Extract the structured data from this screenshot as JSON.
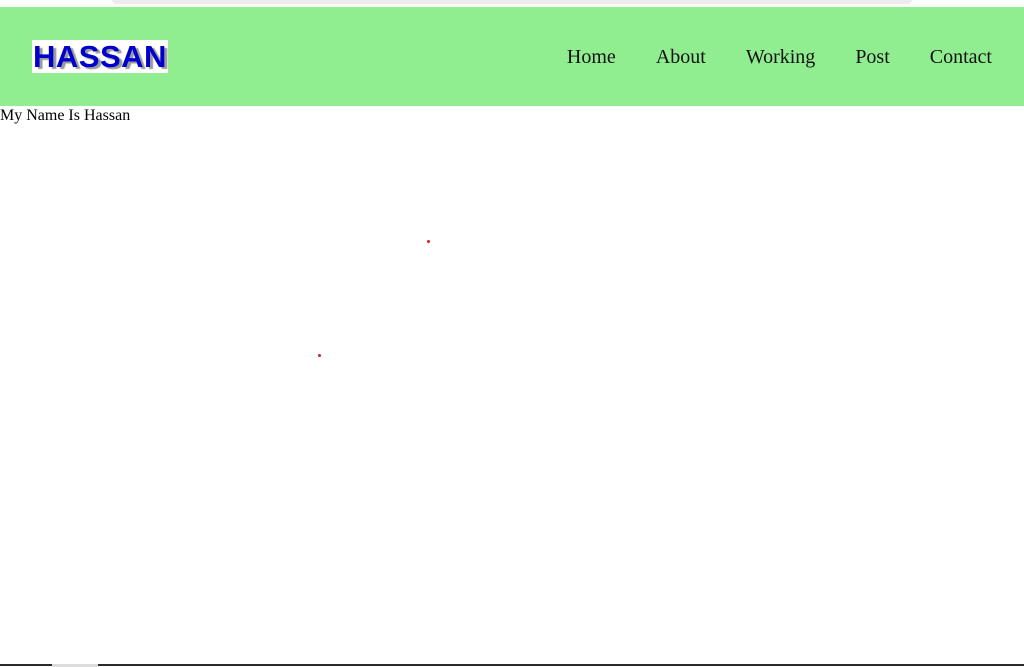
{
  "header": {
    "logo_text": "HASSAN",
    "nav": [
      {
        "label": "Home"
      },
      {
        "label": "About"
      },
      {
        "label": "Working"
      },
      {
        "label": "Post"
      },
      {
        "label": "Contact"
      }
    ]
  },
  "main": {
    "intro_text": "My Name Is Hassan"
  },
  "colors": {
    "navbar_bg": "#90ee90",
    "logo_text": "#0000cd",
    "logo_bg": "#ffffff",
    "nav_text": "#111111",
    "dot": "#d62020"
  }
}
